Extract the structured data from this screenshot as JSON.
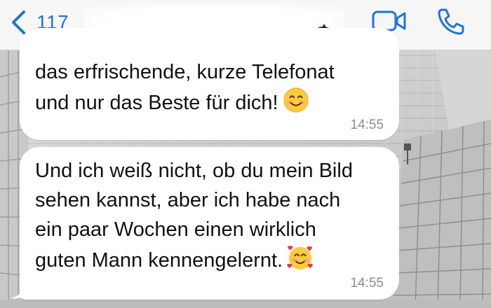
{
  "header": {
    "back_count": "117",
    "contact_name": "",
    "icons": {
      "back": "chevron-left-icon",
      "video": "video-camera-icon",
      "call": "phone-icon"
    },
    "accent_color": "#1f73d8"
  },
  "messages": [
    {
      "text": "das erfrischende, kurze Telefonat\nund nur das Beste für dich!",
      "emoji": "smiling-face-icon",
      "time": "14:55"
    },
    {
      "text": "Und ich weiß nicht, ob du mein Bild\nsehen kannst, aber ich habe nach\nein paar Wochen einen wirklich\nguten Mann kennengelernt.",
      "emoji": "smiling-face-with-hearts-icon",
      "time": "14:55"
    }
  ],
  "colors": {
    "bubble": "#ffffff",
    "timestamp": "#8e8e93",
    "header_bg": "#f7f7f7"
  }
}
